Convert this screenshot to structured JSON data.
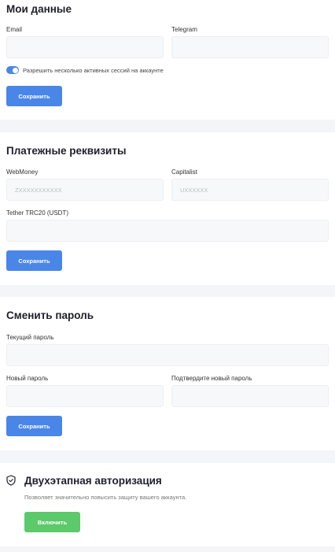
{
  "profile": {
    "title": "Мои данные",
    "email_label": "Email",
    "telegram_label": "Telegram",
    "email_value": "",
    "telegram_value": "",
    "multi_session_label": "Разрешить несколько активных сессий на аккаунте",
    "multi_session_enabled": true,
    "save_label": "Сохранить"
  },
  "payment": {
    "title": "Платежные реквизиты",
    "webmoney_label": "WebMoney",
    "webmoney_placeholder": "ZXXXXXXXXXXX",
    "capitalist_label": "Capitalist",
    "capitalist_placeholder": "UXXXXXX",
    "tether_label": "Tether TRC20 (USDT)",
    "tether_value": "",
    "save_label": "Сохранить"
  },
  "password": {
    "title": "Сменить пароль",
    "current_label": "Текущий пароль",
    "new_label": "Новый пароль",
    "confirm_label": "Подтвердите новый пароль",
    "save_label": "Сохранить"
  },
  "two_factor": {
    "title": "Двухэтапная авторизация",
    "description": "Позволяет значительно повысить защиту вашего аккаунта.",
    "enable_label": "Включить",
    "icon": "shield-icon"
  },
  "colors": {
    "primary": "#4a86e8",
    "success": "#5cc96a",
    "page_background": "#f4f5f8"
  }
}
